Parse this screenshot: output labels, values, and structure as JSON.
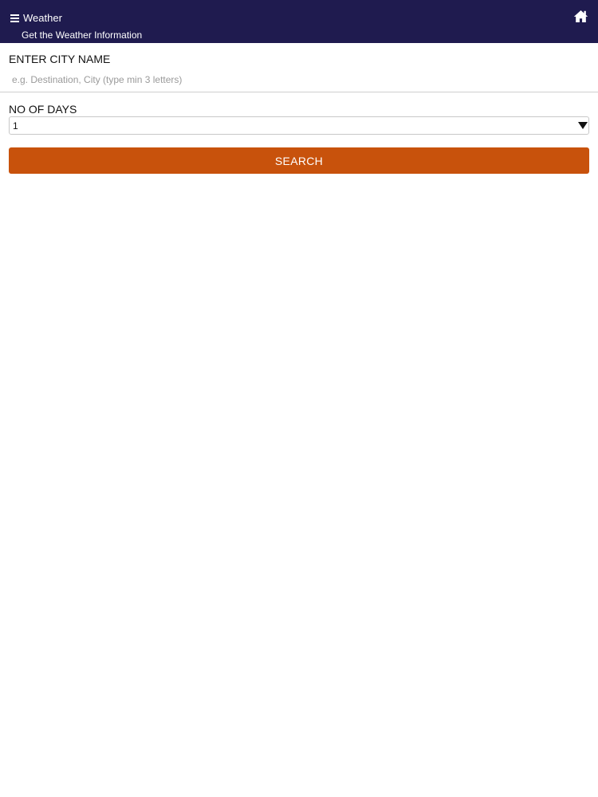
{
  "header": {
    "title": "Weather",
    "subtitle": "Get the Weather Information",
    "menu_icon": "hamburger-menu-icon",
    "home_icon": "home-icon"
  },
  "city": {
    "label": "ENTER CITY NAME",
    "value": "",
    "placeholder": "e.g. Destination, City (type min 3 letters)"
  },
  "days": {
    "label": "NO OF DAYS",
    "selected": "1",
    "arrow_icon": "dropdown-arrow-icon"
  },
  "search": {
    "label": "SEARCH"
  },
  "colors": {
    "header_bg": "#1f1b4f",
    "button_bg": "#c8520c",
    "text": "#111111",
    "placeholder": "#9a9a9a"
  }
}
